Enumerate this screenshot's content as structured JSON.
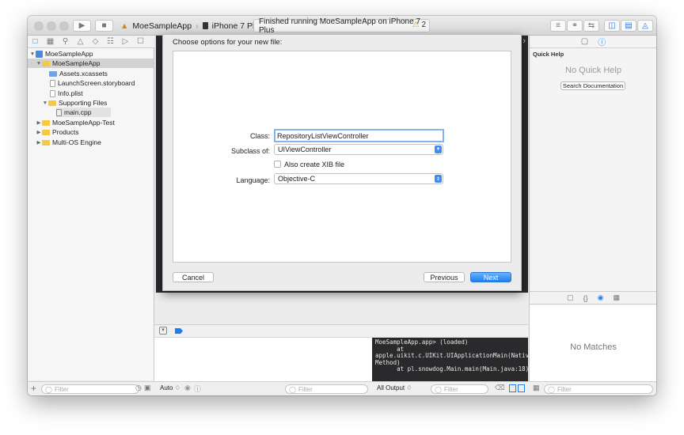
{
  "toolbar": {
    "scheme_name": "MoeSampleApp",
    "device_name": "iPhone 7 Plus",
    "status_text": "Finished running MoeSampleApp on iPhone 7 Plus",
    "warning_count": "2"
  },
  "navigator": {
    "items": [
      {
        "label": "MoeSampleApp",
        "level": 0,
        "kind": "project",
        "disclosure": "open"
      },
      {
        "label": "MoeSampleApp",
        "level": 1,
        "kind": "folder",
        "disclosure": "open",
        "selected": true
      },
      {
        "label": "Assets.xcassets",
        "level": 2,
        "kind": "folder-blue"
      },
      {
        "label": "LaunchScreen.storyboard",
        "level": 2,
        "kind": "storyboard"
      },
      {
        "label": "Info.plist",
        "level": 2,
        "kind": "plist"
      },
      {
        "label": "Supporting Files",
        "level": 2,
        "kind": "folder",
        "disclosure": "open"
      },
      {
        "label": "main.cpp",
        "level": 3,
        "kind": "cpp",
        "highlight": true
      },
      {
        "label": "MoeSampleApp-Test",
        "level": 1,
        "kind": "folder",
        "disclosure": "closed"
      },
      {
        "label": "Products",
        "level": 1,
        "kind": "folder",
        "disclosure": "closed"
      },
      {
        "label": "Multi-OS Engine",
        "level": 1,
        "kind": "folder",
        "disclosure": "closed"
      }
    ],
    "filter_placeholder": "Filter"
  },
  "sheet": {
    "title": "Choose options for your new file:",
    "class_label": "Class:",
    "class_value": "RepositoryListViewController",
    "subclass_label": "Subclass of:",
    "subclass_value": "UIViewController",
    "xib_label": "Also create XIB file",
    "language_label": "Language:",
    "language_value": "Objective-C",
    "cancel": "Cancel",
    "previous": "Previous",
    "next": "Next"
  },
  "inspector": {
    "quick_help_title": "Quick Help",
    "no_quick_help": "No Quick Help",
    "search_docs": "Search Documentation",
    "no_matches": "No Matches",
    "filter_placeholder": "Filter"
  },
  "debug": {
    "auto_label": "Auto ♢",
    "filter_placeholder": "Filter",
    "output_label": "All Output ♢",
    "console_text": "MoeSampleApp.app> (loaded)\n      at\napple.uikit.c.UIKit.UIApplicationMain(Native\nMethod)\n      at pl.snowdog.Main.main(Main.java:18)"
  },
  "colors": {
    "accent": "#1b7ff3",
    "close": "#fc605c",
    "minimize": "#fdbc40",
    "zoom": "#34c84a"
  }
}
